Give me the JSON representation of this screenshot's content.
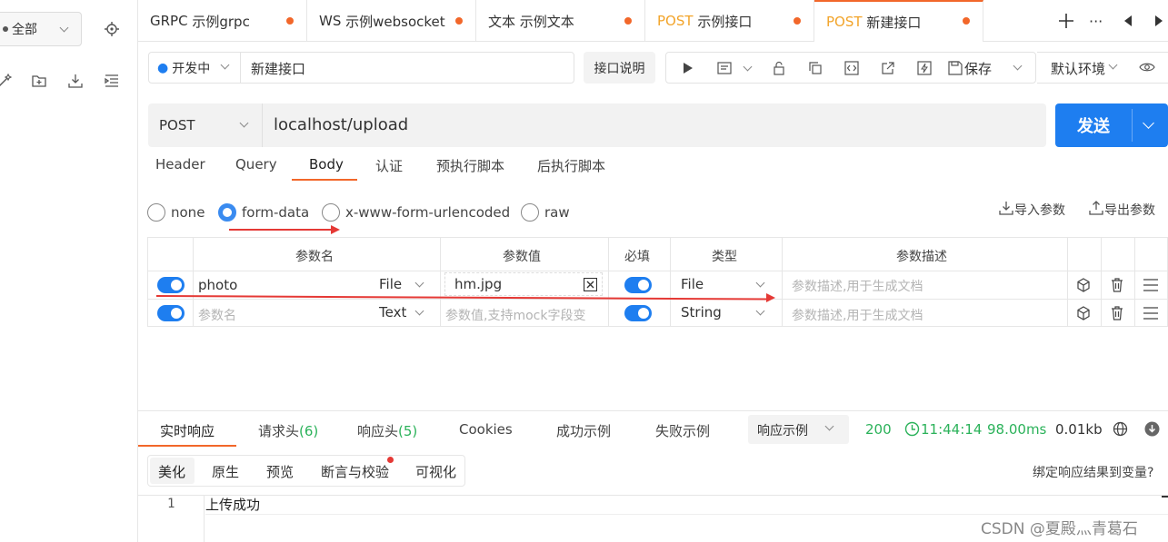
{
  "sidebar": {
    "scope_label": "全部"
  },
  "tabs": [
    {
      "method": "GRPC",
      "label": "示例grpc"
    },
    {
      "method": "WS",
      "label": "示例websocket"
    },
    {
      "method": "文本",
      "label": "示例文本"
    },
    {
      "method": "POST",
      "label": "示例接口"
    },
    {
      "method": "POST",
      "label": "新建接口"
    }
  ],
  "toolbar": {
    "status": "开发中",
    "api_name": "新建接口",
    "doc_button": "接口说明",
    "save_label": "保存",
    "env_label": "默认环境"
  },
  "request": {
    "method": "POST",
    "url": "localhost/upload",
    "send_label": "发送"
  },
  "subtabs": [
    "Header",
    "Query",
    "Body",
    "认证",
    "预执行脚本",
    "后执行脚本"
  ],
  "body_types": [
    "none",
    "form-data",
    "x-www-form-urlencoded",
    "raw"
  ],
  "body_actions": {
    "import": "导入参数",
    "export": "导出参数"
  },
  "table": {
    "headers": [
      "参数名",
      "参数值",
      "必填",
      "类型",
      "参数描述"
    ],
    "rows": [
      {
        "name": "photo",
        "value_type": "File",
        "value": "hm.jpg",
        "type": "File",
        "desc_placeholder": "参数描述,用于生成文档"
      },
      {
        "name_placeholder": "参数名",
        "value_type": "Text",
        "value_placeholder": "参数值,支持mock字段变",
        "type": "String",
        "desc_placeholder": "参数描述,用于生成文档"
      }
    ]
  },
  "response": {
    "tabs": [
      "实时响应",
      "请求头",
      "响应头",
      "Cookies",
      "成功示例",
      "失败示例"
    ],
    "req_header_count": "(6)",
    "resp_header_count": "(5)",
    "example_select": "响应示例",
    "status_code": "200",
    "time": "11:44:14",
    "duration": "98.00ms",
    "size": "0.01kb",
    "view_tabs": [
      "美化",
      "原生",
      "预览",
      "断言与校验",
      "可视化"
    ],
    "bind_link": "绑定响应结果到变量?",
    "line_number": "1",
    "body_text": "上传成功"
  },
  "watermark": "CSDN @夏殿灬青葛石",
  "colors": {
    "accent": "#1e7ef0",
    "orange": "#f2672a",
    "green": "#2bb25a",
    "annotation": "#e53935"
  }
}
